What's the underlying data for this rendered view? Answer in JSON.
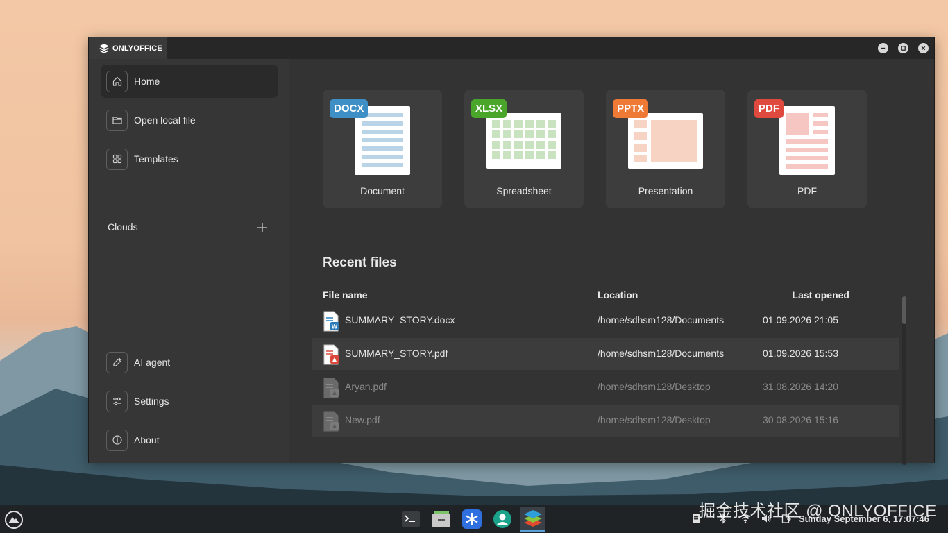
{
  "app": {
    "title": "ONLYOFFICE"
  },
  "sidebar": {
    "items": [
      {
        "label": "Home",
        "icon": "home-icon"
      },
      {
        "label": "Open local file",
        "icon": "folder-icon"
      },
      {
        "label": "Templates",
        "icon": "templates-icon"
      }
    ],
    "clouds_label": "Clouds",
    "bottom_items": [
      {
        "label": "AI agent",
        "icon": "ai-agent-icon"
      },
      {
        "label": "Settings",
        "icon": "settings-sliders-icon"
      },
      {
        "label": "About",
        "icon": "info-icon"
      }
    ]
  },
  "create": [
    {
      "badge": "DOCX",
      "label": "Document",
      "color": "#3e8fc6"
    },
    {
      "badge": "XLSX",
      "label": "Spreadsheet",
      "color": "#4aa62b"
    },
    {
      "badge": "PPTX",
      "label": "Presentation",
      "color": "#ef7a36"
    },
    {
      "badge": "PDF",
      "label": "PDF",
      "color": "#e04a3e"
    }
  ],
  "recent": {
    "title": "Recent files",
    "columns": {
      "name": "File name",
      "location": "Location",
      "opened": "Last opened"
    },
    "files": [
      {
        "name": "SUMMARY_STORY.docx",
        "location": "/home/sdhsm128/Documents",
        "opened": "01.09.2026 21:05",
        "type": "docx"
      },
      {
        "name": "SUMMARY_STORY.pdf",
        "location": "/home/sdhsm128/Documents",
        "opened": "01.09.2026 15:53",
        "type": "pdf"
      },
      {
        "name": "Aryan.pdf",
        "location": "/home/sdhsm128/Desktop",
        "opened": "31.08.2026 14:20",
        "type": "pdf-missing"
      },
      {
        "name": "New.pdf",
        "location": "/home/sdhsm128/Desktop",
        "opened": "30.08.2026 15:16",
        "type": "pdf-missing"
      }
    ]
  },
  "taskbar": {
    "clock": "Sunday September 6, 17:07:46",
    "watermark": "掘金技术社区 @ ONLYOFFICE",
    "apps": [
      "terminal-icon",
      "file-manager-icon",
      "snowflake-app-icon",
      "contacts-icon",
      "onlyoffice-icon"
    ]
  }
}
